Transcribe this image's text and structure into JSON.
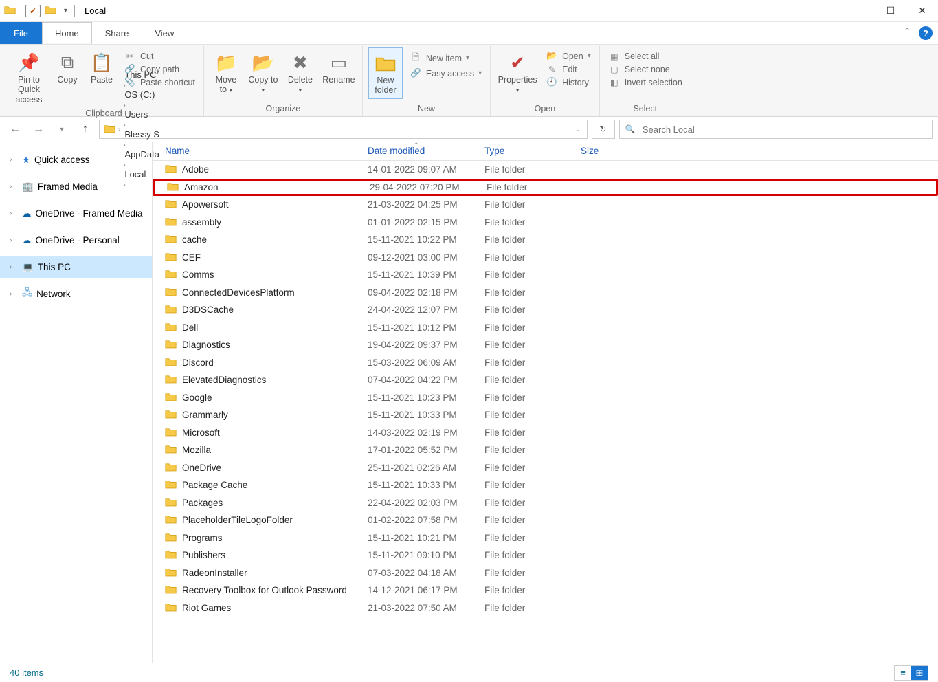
{
  "window": {
    "title": "Local"
  },
  "tabs": {
    "file": "File",
    "home": "Home",
    "share": "Share",
    "view": "View"
  },
  "ribbon": {
    "clipboard": {
      "label": "Clipboard",
      "pin": "Pin to Quick access",
      "copy": "Copy",
      "paste": "Paste",
      "cut": "Cut",
      "copy_path": "Copy path",
      "paste_shortcut": "Paste shortcut"
    },
    "organize": {
      "label": "Organize",
      "move_to": "Move to",
      "copy_to": "Copy to",
      "delete": "Delete",
      "rename": "Rename"
    },
    "new": {
      "label": "New",
      "new_folder": "New folder",
      "new_item": "New item",
      "easy_access": "Easy access"
    },
    "open": {
      "label": "Open",
      "properties": "Properties",
      "open": "Open",
      "edit": "Edit",
      "history": "History"
    },
    "select": {
      "label": "Select",
      "select_all": "Select all",
      "select_none": "Select none",
      "invert": "Invert selection"
    }
  },
  "breadcrumb": [
    "This PC",
    "OS (C:)",
    "Users",
    "Blessy S",
    "AppData",
    "Local"
  ],
  "search": {
    "placeholder": "Search Local"
  },
  "columns": {
    "name": "Name",
    "date": "Date modified",
    "type": "Type",
    "size": "Size"
  },
  "nav": {
    "quick_access": "Quick access",
    "framed_media": "Framed Media",
    "onedrive_fm": "OneDrive - Framed Media",
    "onedrive_personal": "OneDrive - Personal",
    "this_pc": "This PC",
    "network": "Network"
  },
  "files": [
    {
      "name": "Adobe",
      "date": "14-01-2022 09:07 AM",
      "type": "File folder",
      "highlight": false
    },
    {
      "name": "Amazon",
      "date": "29-04-2022 07:20 PM",
      "type": "File folder",
      "highlight": true
    },
    {
      "name": "Apowersoft",
      "date": "21-03-2022 04:25 PM",
      "type": "File folder",
      "highlight": false
    },
    {
      "name": "assembly",
      "date": "01-01-2022 02:15 PM",
      "type": "File folder",
      "highlight": false
    },
    {
      "name": "cache",
      "date": "15-11-2021 10:22 PM",
      "type": "File folder",
      "highlight": false
    },
    {
      "name": "CEF",
      "date": "09-12-2021 03:00 PM",
      "type": "File folder",
      "highlight": false
    },
    {
      "name": "Comms",
      "date": "15-11-2021 10:39 PM",
      "type": "File folder",
      "highlight": false
    },
    {
      "name": "ConnectedDevicesPlatform",
      "date": "09-04-2022 02:18 PM",
      "type": "File folder",
      "highlight": false
    },
    {
      "name": "D3DSCache",
      "date": "24-04-2022 12:07 PM",
      "type": "File folder",
      "highlight": false
    },
    {
      "name": "Dell",
      "date": "15-11-2021 10:12 PM",
      "type": "File folder",
      "highlight": false
    },
    {
      "name": "Diagnostics",
      "date": "19-04-2022 09:37 PM",
      "type": "File folder",
      "highlight": false
    },
    {
      "name": "Discord",
      "date": "15-03-2022 06:09 AM",
      "type": "File folder",
      "highlight": false
    },
    {
      "name": "ElevatedDiagnostics",
      "date": "07-04-2022 04:22 PM",
      "type": "File folder",
      "highlight": false
    },
    {
      "name": "Google",
      "date": "15-11-2021 10:23 PM",
      "type": "File folder",
      "highlight": false
    },
    {
      "name": "Grammarly",
      "date": "15-11-2021 10:33 PM",
      "type": "File folder",
      "highlight": false
    },
    {
      "name": "Microsoft",
      "date": "14-03-2022 02:19 PM",
      "type": "File folder",
      "highlight": false
    },
    {
      "name": "Mozilla",
      "date": "17-01-2022 05:52 PM",
      "type": "File folder",
      "highlight": false
    },
    {
      "name": "OneDrive",
      "date": "25-11-2021 02:26 AM",
      "type": "File folder",
      "highlight": false
    },
    {
      "name": "Package Cache",
      "date": "15-11-2021 10:33 PM",
      "type": "File folder",
      "highlight": false
    },
    {
      "name": "Packages",
      "date": "22-04-2022 02:03 PM",
      "type": "File folder",
      "highlight": false
    },
    {
      "name": "PlaceholderTileLogoFolder",
      "date": "01-02-2022 07:58 PM",
      "type": "File folder",
      "highlight": false
    },
    {
      "name": "Programs",
      "date": "15-11-2021 10:21 PM",
      "type": "File folder",
      "highlight": false
    },
    {
      "name": "Publishers",
      "date": "15-11-2021 09:10 PM",
      "type": "File folder",
      "highlight": false
    },
    {
      "name": "RadeonInstaller",
      "date": "07-03-2022 04:18 AM",
      "type": "File folder",
      "highlight": false
    },
    {
      "name": "Recovery Toolbox for Outlook Password",
      "date": "14-12-2021 06:17 PM",
      "type": "File folder",
      "highlight": false
    },
    {
      "name": "Riot Games",
      "date": "21-03-2022 07:50 AM",
      "type": "File folder",
      "highlight": false
    }
  ],
  "status": {
    "items": "40 items"
  }
}
